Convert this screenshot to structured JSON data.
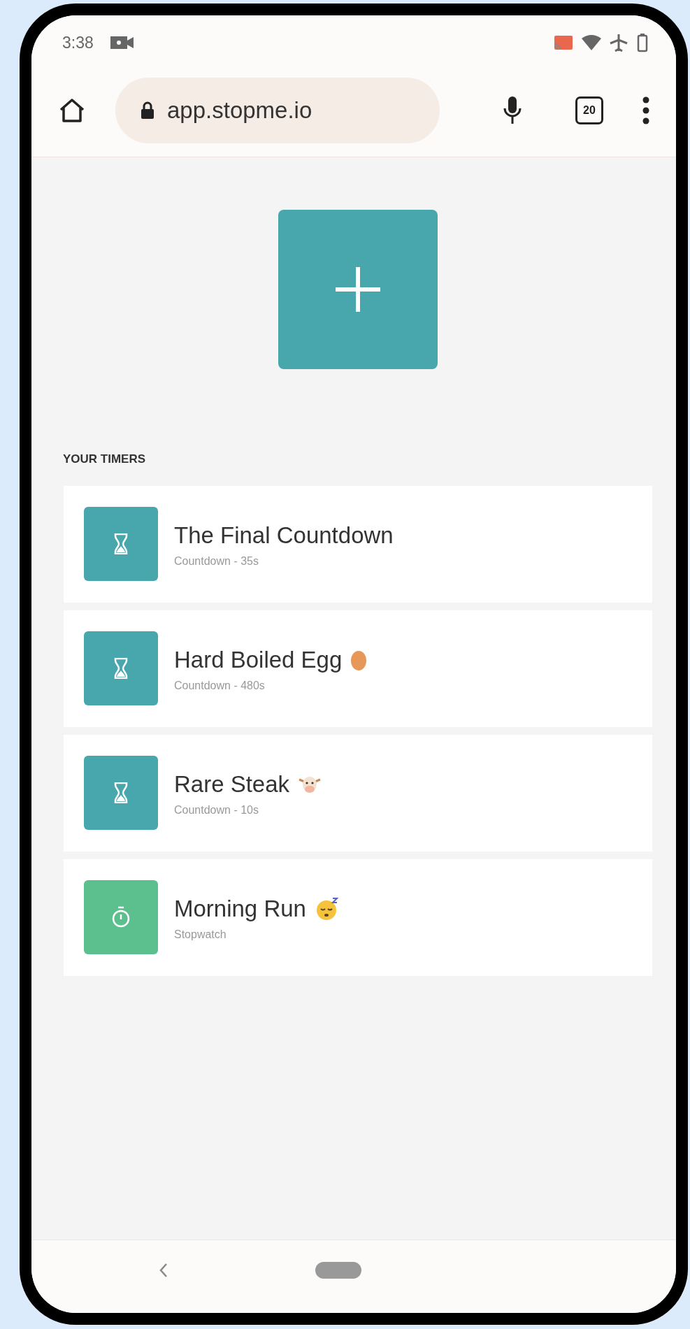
{
  "status_bar": {
    "time": "3:38"
  },
  "browser": {
    "url": "app.stopme.io",
    "tab_count": "20"
  },
  "section_title": "YOUR TIMERS",
  "timers": [
    {
      "kind": "countdown",
      "title": "The Final Countdown",
      "subtitle": "Countdown - 35s"
    },
    {
      "kind": "countdown",
      "title": "Hard Boiled Egg",
      "emoji": {
        "kind": "egg"
      },
      "subtitle": "Countdown - 480s"
    },
    {
      "kind": "countdown",
      "title": "Rare Steak",
      "emoji": {
        "kind": "cow"
      },
      "subtitle": "Countdown - 10s"
    },
    {
      "kind": "stopwatch",
      "title": "Morning Run",
      "emoji": {
        "kind": "sleepy"
      },
      "subtitle": "Stopwatch"
    }
  ]
}
